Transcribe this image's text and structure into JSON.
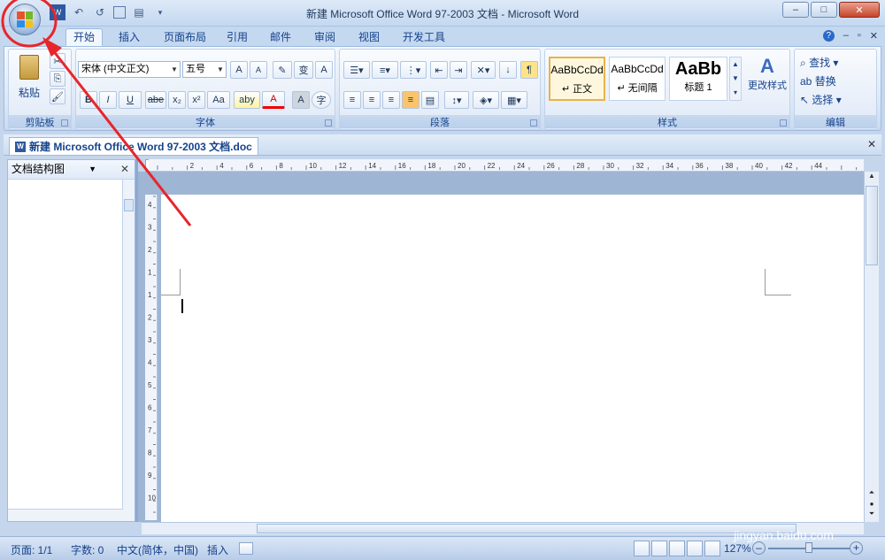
{
  "window": {
    "title": "新建 Microsoft Office Word 97-2003 文档 - Microsoft Word",
    "min": "–",
    "max": "□",
    "close": "✕"
  },
  "qat": {
    "save": "💾",
    "undo": "↶",
    "redo": "↺",
    "print": "▤",
    "more": "▾"
  },
  "tabs": [
    {
      "label": "开始",
      "active": true
    },
    {
      "label": "插入"
    },
    {
      "label": "页面布局"
    },
    {
      "label": "引用"
    },
    {
      "label": "邮件"
    },
    {
      "label": "审阅"
    },
    {
      "label": "视图"
    },
    {
      "label": "开发工具"
    }
  ],
  "tabs_right": {
    "help": "?",
    "min": "–",
    "restore": "▫",
    "close": "✕"
  },
  "ribbon": {
    "clipboard": {
      "label": "剪贴板",
      "paste": "粘贴"
    },
    "font": {
      "label": "字体",
      "font_name": "宋体 (中文正文)",
      "font_size": "五号",
      "grow": "A",
      "shrink": "A",
      "bold": "B",
      "italic": "I",
      "underline": "U",
      "strike": "abe",
      "sub": "x₂",
      "sup": "x²",
      "case": "Aa",
      "highlight": "aby",
      "color": "A",
      "phonetic": "变",
      "border": "A",
      "enclose": "字"
    },
    "paragraph": {
      "label": "段落"
    },
    "styles": {
      "label": "样式",
      "items": [
        {
          "sample": "AaBbCcDd",
          "name": "↵ 正文"
        },
        {
          "sample": "AaBbCcDd",
          "name": "↵ 无间隔"
        },
        {
          "sample": "AaBb",
          "name": "标题 1"
        }
      ],
      "change": "更改样式"
    },
    "editing": {
      "label": "编辑",
      "find": "查找",
      "replace": "替换",
      "select": "选择"
    }
  },
  "document_tab": {
    "name": "新建 Microsoft Office Word 97-2003 文档.doc",
    "close": "✕"
  },
  "nav_pane": {
    "title": "文档结构图",
    "close": "✕"
  },
  "ruler_numbers": [
    "2",
    "4",
    "6",
    "8",
    "10",
    "12",
    "14",
    "16",
    "18",
    "20",
    "22",
    "24",
    "26",
    "28",
    "30",
    "32",
    "34",
    "36",
    "38",
    "40",
    "42",
    "44"
  ],
  "vruler_numbers": [
    "4",
    "3",
    "2",
    "1",
    "1",
    "2",
    "3",
    "4",
    "5",
    "6",
    "7",
    "8",
    "9",
    "10"
  ],
  "status": {
    "page": "页面: 1/1",
    "words": "字数: 0",
    "lang": "中文(简体，中国)",
    "insert": "插入",
    "zoom": "127%"
  },
  "watermark": {
    "brand": "Baidu 经验",
    "url": "jingyan.baidu.com"
  },
  "colors": {
    "annotation": "#e8252b",
    "accent": "#15428b"
  }
}
